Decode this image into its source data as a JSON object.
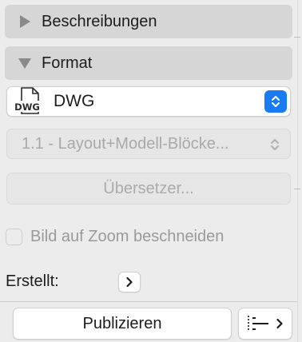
{
  "sections": {
    "descriptions": {
      "label": "Beschreibungen",
      "expanded": false
    },
    "format": {
      "label": "Format",
      "expanded": true
    }
  },
  "format": {
    "selected": "DWG",
    "file_icon_text": "DWG",
    "layout_option": "1.1 - Layout+Modell-Blöcke...",
    "layout_enabled": false
  },
  "translator_button": {
    "label": "Übersetzer...",
    "enabled": false
  },
  "crop_checkbox": {
    "label": "Bild auf Zoom beschneiden",
    "checked": false,
    "enabled": false
  },
  "created": {
    "label": "Erstellt:"
  },
  "footer": {
    "publish_label": "Publizieren"
  },
  "icons": {
    "descriptions_toggle": "disclosure-right-icon",
    "format_toggle": "disclosure-down-icon",
    "file": "dwg-file-icon",
    "format_stepper": "up-down-chevrons-icon",
    "created_arrow": "chevron-right-icon",
    "options": "list-options-icon"
  },
  "colors": {
    "accent": "#1a7cf5",
    "panel_bg": "#ececec",
    "header_bg": "#d6d6d6"
  }
}
